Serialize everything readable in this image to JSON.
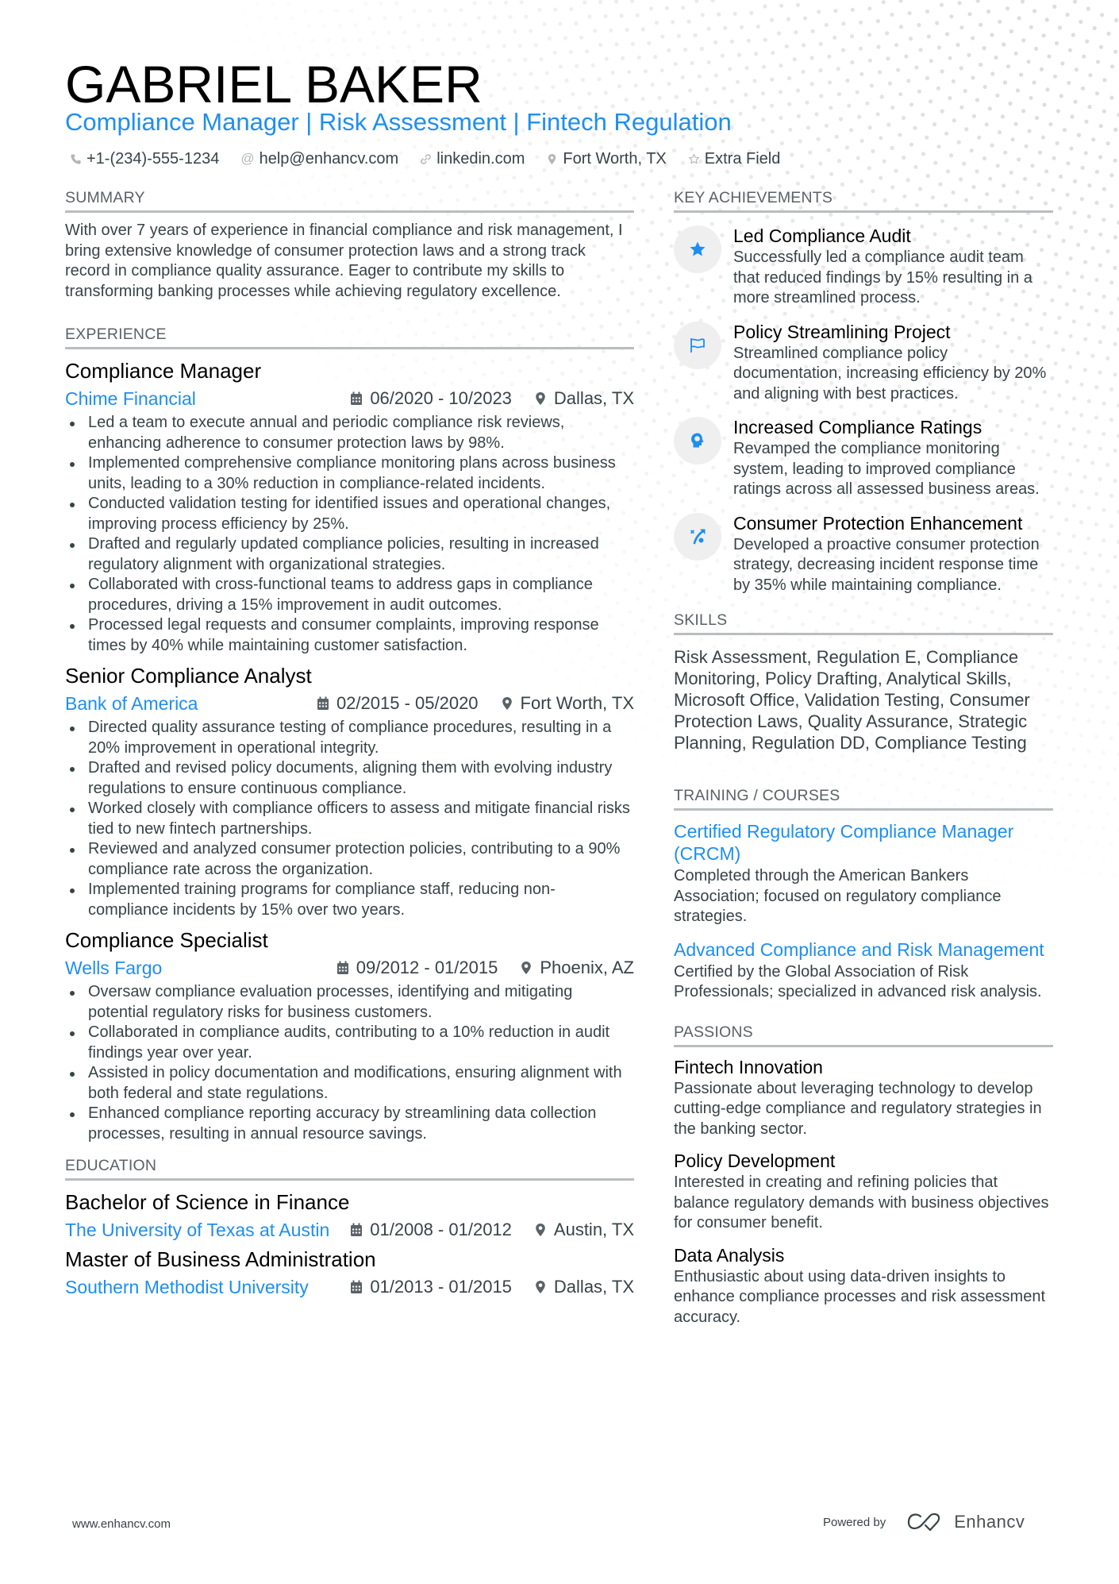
{
  "header": {
    "name": "GABRIEL BAKER",
    "subtitle": "Compliance Manager | Risk Assessment | Fintech Regulation",
    "contacts": [
      {
        "icon": "phone-icon",
        "text": "+1-(234)-555-1234"
      },
      {
        "icon": "at-icon",
        "text": "help@enhancv.com"
      },
      {
        "icon": "link-icon",
        "text": "linkedin.com"
      },
      {
        "icon": "location-icon",
        "text": "Fort Worth, TX"
      },
      {
        "icon": "star-outline-icon",
        "text": "Extra Field"
      }
    ]
  },
  "summary": {
    "title": "SUMMARY",
    "text": "With over 7 years of experience in financial compliance and risk management, I bring extensive knowledge of consumer protection laws and a strong track record in compliance quality assurance. Eager to contribute my skills to transforming banking processes while achieving regulatory excellence."
  },
  "experience": {
    "title": "EXPERIENCE",
    "jobs": [
      {
        "title": "Compliance Manager",
        "company": "Chime Financial",
        "dates": "06/2020 - 10/2023",
        "location": "Dallas, TX",
        "bullets": [
          "Led a team to execute annual and periodic compliance risk reviews, enhancing adherence to consumer protection laws by 98%.",
          "Implemented comprehensive compliance monitoring plans across business units, leading to a 30% reduction in compliance-related incidents.",
          "Conducted validation testing for identified issues and operational changes, improving process efficiency by 25%.",
          "Drafted and regularly updated compliance policies, resulting in increased regulatory alignment with organizational strategies.",
          "Collaborated with cross-functional teams to address gaps in compliance procedures, driving a 15% improvement in audit outcomes.",
          "Processed legal requests and consumer complaints, improving response times by 40% while maintaining customer satisfaction."
        ]
      },
      {
        "title": "Senior Compliance Analyst",
        "company": "Bank of America",
        "dates": "02/2015 - 05/2020",
        "location": "Fort Worth, TX",
        "bullets": [
          "Directed quality assurance testing of compliance procedures, resulting in a 20% improvement in operational integrity.",
          "Drafted and revised policy documents, aligning them with evolving industry regulations to ensure continuous compliance.",
          "Worked closely with compliance officers to assess and mitigate financial risks tied to new fintech partnerships.",
          "Reviewed and analyzed consumer protection policies, contributing to a 90% compliance rate across the organization.",
          "Implemented training programs for compliance staff, reducing non-compliance incidents by 15% over two years."
        ]
      },
      {
        "title": "Compliance Specialist",
        "company": "Wells Fargo",
        "dates": "09/2012 - 01/2015",
        "location": "Phoenix, AZ",
        "bullets": [
          "Oversaw compliance evaluation processes, identifying and mitigating potential regulatory risks for business customers.",
          "Collaborated in compliance audits, contributing to a 10% reduction in audit findings year over year.",
          "Assisted in policy documentation and modifications, ensuring alignment with both federal and state regulations.",
          "Enhanced compliance reporting accuracy by streamlining data collection processes, resulting in annual resource savings."
        ]
      }
    ]
  },
  "education": {
    "title": "EDUCATION",
    "items": [
      {
        "degree": "Bachelor of Science in Finance",
        "school": "The University of Texas at Austin",
        "dates": "01/2008 - 01/2012",
        "location": "Austin, TX"
      },
      {
        "degree": "Master of Business Administration",
        "school": "Southern Methodist University",
        "dates": "01/2013 - 01/2015",
        "location": "Dallas, TX"
      }
    ]
  },
  "achievements": {
    "title": "KEY ACHIEVEMENTS",
    "items": [
      {
        "icon": "star-icon",
        "title": "Led Compliance Audit",
        "desc": "Successfully led a compliance audit team that reduced findings by 15% resulting in a more streamlined process."
      },
      {
        "icon": "flag-icon",
        "title": "Policy Streamlining Project",
        "desc": "Streamlined compliance policy documentation, increasing efficiency by 20% and aligning with best practices."
      },
      {
        "icon": "head-brain-icon",
        "title": "Increased Compliance Ratings",
        "desc": "Revamped the compliance monitoring system, leading to improved compliance ratings across all assessed business areas."
      },
      {
        "icon": "strategy-icon",
        "title": "Consumer Protection Enhancement",
        "desc": "Developed a proactive consumer protection strategy, decreasing incident response time by 35% while maintaining compliance."
      }
    ]
  },
  "skills": {
    "title": "SKILLS",
    "text": "Risk Assessment, Regulation E, Compliance Monitoring, Policy Drafting, Analytical Skills, Microsoft Office, Validation Testing, Consumer Protection Laws, Quality Assurance, Strategic Planning, Regulation DD, Compliance Testing"
  },
  "training": {
    "title": "TRAINING / COURSES",
    "items": [
      {
        "title": "Certified Regulatory Compliance Manager (CRCM)",
        "desc": "Completed through the American Bankers Association; focused on regulatory compliance strategies."
      },
      {
        "title": "Advanced Compliance and Risk Management",
        "desc": "Certified by the Global Association of Risk Professionals; specialized in advanced risk analysis."
      }
    ]
  },
  "passions": {
    "title": "PASSIONS",
    "items": [
      {
        "title": "Fintech Innovation",
        "desc": "Passionate about leveraging technology to develop cutting-edge compliance and regulatory strategies in the banking sector."
      },
      {
        "title": "Policy Development",
        "desc": "Interested in creating and refining policies that balance regulatory demands with business objectives for consumer benefit."
      },
      {
        "title": "Data Analysis",
        "desc": "Enthusiastic about using data-driven insights to enhance compliance processes and risk assessment accuracy."
      }
    ]
  },
  "footer": {
    "website": "www.enhancv.com",
    "powered_by": "Powered by",
    "brand": "Enhancv"
  },
  "colors": {
    "accent": "#1e8ef0",
    "text": "#384347",
    "heading": "#000000",
    "section_title": "#5a6266",
    "rule": "#b9bdbf",
    "icon_circle": "#efefef"
  }
}
